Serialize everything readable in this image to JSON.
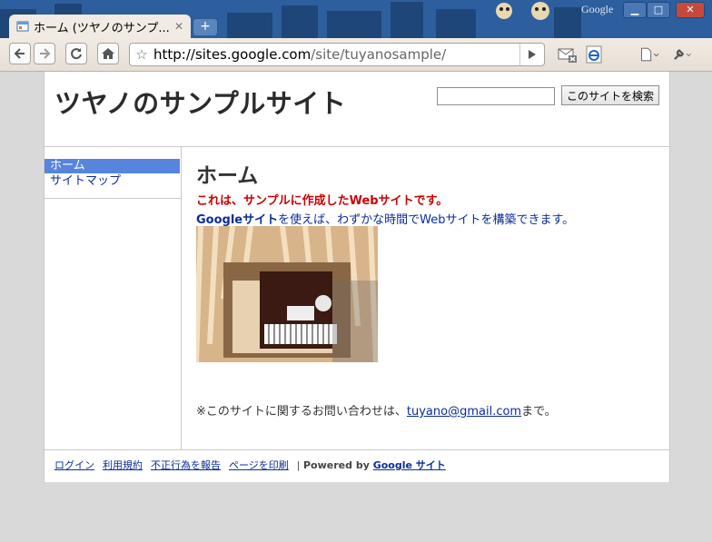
{
  "browser": {
    "tab_title": "ホーム (ツヤノのサンプ...",
    "new_tab": "+",
    "brand_mark": "Google",
    "url_host": "http://sites.google.com",
    "url_path": "/site/tuyanosample/",
    "icons": {
      "back": "back-arrow-icon",
      "forward": "forward-arrow-icon",
      "reload": "reload-icon",
      "home": "home-icon",
      "bookmark": "star-icon",
      "go": "play-icon",
      "gmail_ext": "mail-icon",
      "ie_tab_ext": "ie-icon",
      "page_menu": "page-menu-icon",
      "tools_menu": "wrench-icon"
    }
  },
  "site": {
    "title": "ツヤノのサンプルサイト",
    "search_button": "このサイトを検索",
    "search_value": ""
  },
  "sidebar": {
    "items": [
      {
        "label": "ホーム",
        "active": true
      },
      {
        "label": "サイトマップ",
        "active": false
      }
    ]
  },
  "main": {
    "heading": "ホーム",
    "lead_red": "これは、サンプルに作成したWebサイトです。",
    "lead_blue_bold": "Googleサイト",
    "lead_blue_rest": "を使えば、わずかな時間でWebサイトを構築できます。",
    "contact_prefix": "※このサイトに関するお問い合わせは、",
    "contact_email": "tuyano@gmail.com",
    "contact_suffix": "まで。"
  },
  "footer": {
    "links": [
      "ログイン",
      "利用規約",
      "不正行為を報告",
      "ページを印刷"
    ],
    "separator": "|",
    "powered_prefix": "Powered by",
    "powered_link": "Google サイト"
  }
}
